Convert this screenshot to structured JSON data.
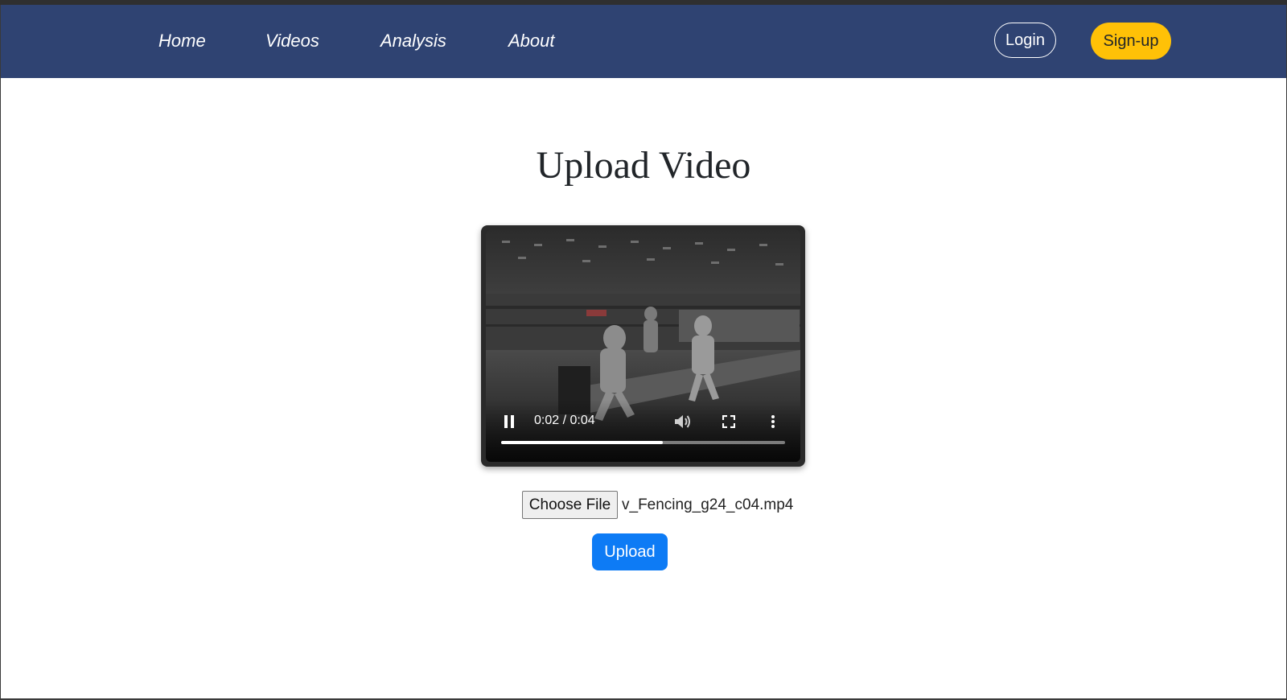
{
  "nav": {
    "links": [
      {
        "label": "Home"
      },
      {
        "label": "Videos"
      },
      {
        "label": "Analysis"
      },
      {
        "label": "About"
      }
    ],
    "login_label": "Login",
    "signup_label": "Sign-up"
  },
  "main": {
    "title": "Upload Video",
    "video": {
      "time_display": "0:02 / 0:04",
      "progress": 0.57,
      "playing": true
    },
    "file_input": {
      "button_label": "Choose File",
      "file_name": "v_Fencing_g24_c04.mp4"
    },
    "upload_label": "Upload"
  },
  "colors": {
    "navbar": "#2f4372",
    "signup": "#ffc107",
    "upload": "#0d7bf5"
  },
  "icons": [
    "pause-icon",
    "volume-icon",
    "fullscreen-icon",
    "more-options-icon"
  ]
}
